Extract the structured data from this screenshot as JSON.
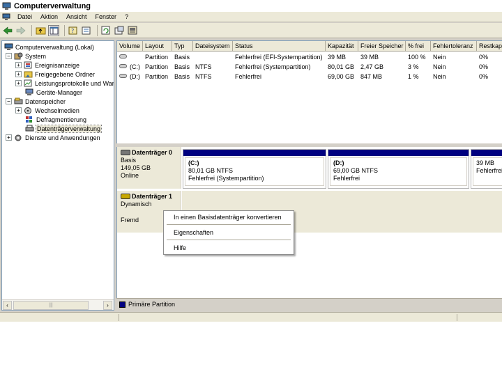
{
  "window": {
    "title": "Computerverwaltung"
  },
  "menu": {
    "items": [
      "Datei",
      "Aktion",
      "Ansicht",
      "Fenster",
      "?"
    ]
  },
  "toolbar": {
    "icons": [
      "back-arrow-icon",
      "forward-arrow-icon",
      "up-folder-icon",
      "show-tree-icon",
      "help-icon",
      "refresh-icon",
      "properties-icon",
      "export-icon",
      "console-icon"
    ]
  },
  "tree": {
    "root": "Computerverwaltung (Lokal)",
    "system": "System",
    "ereignis": "Ereignisanzeige",
    "freigaben": "Freigegebene Ordner",
    "leistung": "Leistungsprotokolle und War",
    "geraete": "Geräte-Manager",
    "datenspeicher": "Datenspeicher",
    "wechsel": "Wechselmedien",
    "defrag": "Defragmentierung",
    "dtv": "Datenträgerverwaltung",
    "dienste": "Dienste und Anwendungen",
    "scroll_thumb": "|||"
  },
  "grid": {
    "headers": [
      "Volume",
      "Layout",
      "Typ",
      "Dateisystem",
      "Status",
      "Kapazität",
      "Freier Speicher",
      "% frei",
      "Fehlertoleranz",
      "Restkap"
    ],
    "rows": [
      [
        "",
        "Partition",
        "Basis",
        "",
        "Fehlerfrei (EFI-Systempartition)",
        "39 MB",
        "39 MB",
        "100 %",
        "Nein",
        "0%"
      ],
      [
        "(C:)",
        "Partition",
        "Basis",
        "NTFS",
        "Fehlerfrei (Systempartition)",
        "80,01 GB",
        "2,47 GB",
        "3 %",
        "Nein",
        "0%"
      ],
      [
        "(D:)",
        "Partition",
        "Basis",
        "NTFS",
        "Fehlerfrei",
        "69,00 GB",
        "847 MB",
        "1 %",
        "Nein",
        "0%"
      ]
    ]
  },
  "disks": {
    "disk0": {
      "name": "Datenträger 0",
      "type": "Basis",
      "size": "149,05 GB",
      "state": "Online",
      "partitions": [
        {
          "name": "(C:)",
          "size": "80,01 GB NTFS",
          "status": "Fehlerfrei (Systempartition)"
        },
        {
          "name": "(D:)",
          "size": "69,00 GB NTFS",
          "status": "Fehlerfrei"
        },
        {
          "name": "",
          "size": "39 MB",
          "status": "Fehlerfrei ("
        }
      ]
    },
    "disk1": {
      "name": "Datenträger 1",
      "type": "Dynamisch",
      "state": "Fremd"
    }
  },
  "context_menu": {
    "convert": "In einen Basisdatenträger konvertieren",
    "properties": "Eigenschaften",
    "help": "Hilfe"
  },
  "legend": {
    "primary": "Primäre Partition",
    "primary_color": "#000080"
  }
}
